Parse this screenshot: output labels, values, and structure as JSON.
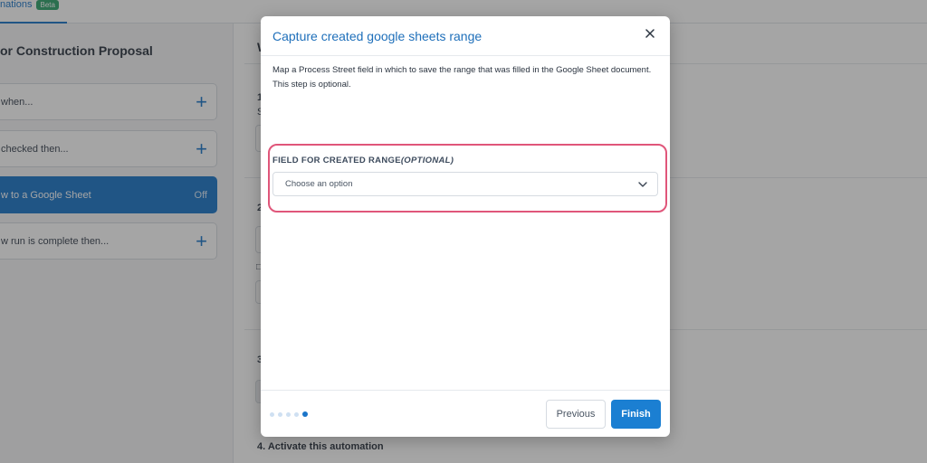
{
  "background": {
    "tab_label": "nations",
    "tab_badge": "Beta",
    "left_title": "or Construction Proposal",
    "cards": [
      {
        "label": "when..."
      },
      {
        "label": "checked then..."
      },
      {
        "label": "w to a Google Sheet",
        "status": "Off"
      },
      {
        "label": "w run is complete then..."
      }
    ],
    "right_title": "W",
    "step_numbers": [
      "1",
      "2",
      "3"
    ],
    "step1_sub": "S",
    "step4_label": "4. Activate this automation"
  },
  "modal": {
    "title": "Capture created google sheets range",
    "description": "Map a Process Street field in which to save the range that was filled in the Google Sheet document. This step is optional.",
    "field_label": "FIELD FOR CREATED RANGE",
    "field_label_optional": "(OPTIONAL)",
    "select_value": "Choose an option",
    "previous_label": "Previous",
    "finish_label": "Finish",
    "steps_total": 5,
    "current_step": 5,
    "highlight_color": "#e0567a",
    "accent_color": "#1b75c9"
  }
}
